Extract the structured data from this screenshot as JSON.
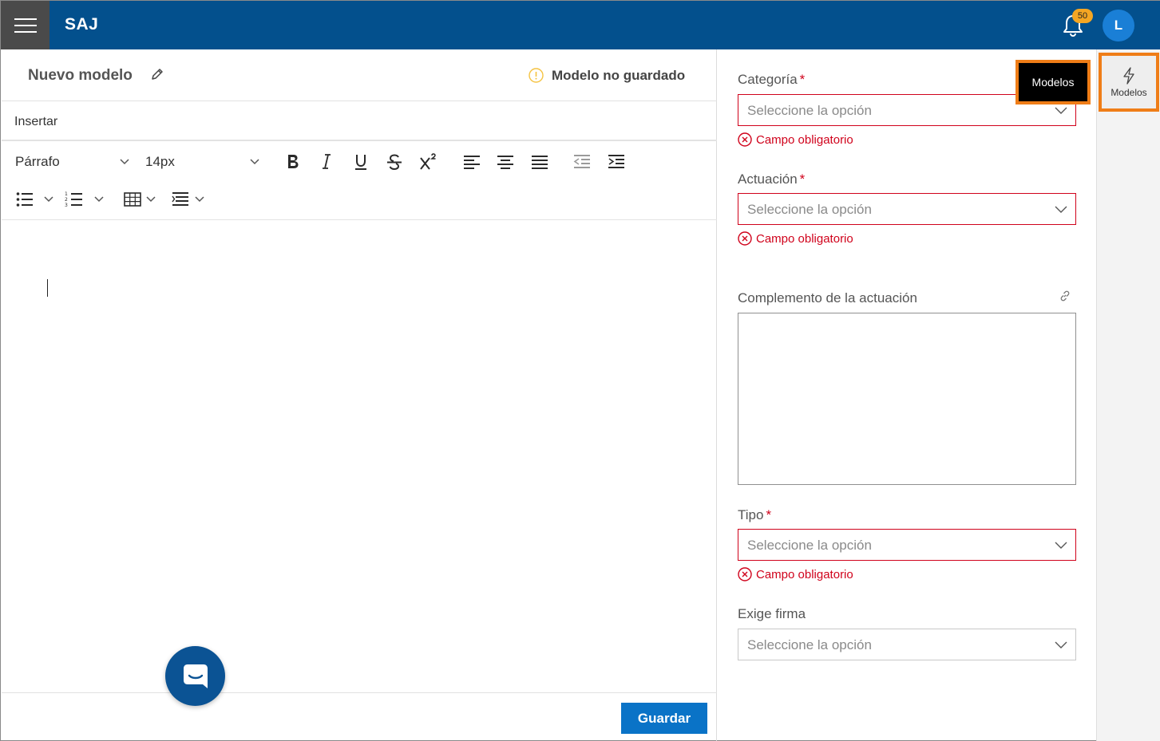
{
  "app": {
    "brand": "SAJ",
    "notification_count": "50",
    "user_initial": "L"
  },
  "editor": {
    "model_name": "Nuevo modelo",
    "status": "Modelo no guardado",
    "insert_label": "Insertar",
    "paragraph_style": "Párrafo",
    "font_size": "14px",
    "save_label": "Guardar"
  },
  "form": {
    "category": {
      "label": "Categoría",
      "required_mark": "*",
      "placeholder": "Seleccione la opción",
      "error": "Campo obligatorio"
    },
    "action": {
      "label": "Actuación",
      "required_mark": "*",
      "placeholder": "Seleccione la opción",
      "error": "Campo obligatorio"
    },
    "complement": {
      "label": "Complemento de la actuación",
      "value": ""
    },
    "type": {
      "label": "Tipo",
      "required_mark": "*",
      "placeholder": "Seleccione la opción",
      "error": "Campo obligatorio"
    },
    "signature": {
      "label": "Exige firma",
      "placeholder": "Seleccione la opción"
    }
  },
  "rail": {
    "models_label": "Modelos",
    "tooltip": "Modelos"
  },
  "colors": {
    "topbar": "#03508d",
    "accent": "#0a73c7",
    "error": "#d0021b",
    "highlight": "#ef7d17",
    "badge": "#f5a623"
  },
  "icons": [
    "menu-icon",
    "bell-icon",
    "pencil-icon",
    "info-icon",
    "bold-icon",
    "italic-icon",
    "underline-icon",
    "strikethrough-icon",
    "superscript-icon",
    "align-left-icon",
    "align-center-icon",
    "align-justify-icon",
    "outdent-icon",
    "indent-icon",
    "bullet-list-icon",
    "numbered-list-icon",
    "table-icon",
    "list-style-icon",
    "chat-icon",
    "link-icon",
    "error-circle-icon",
    "lightning-icon"
  ]
}
